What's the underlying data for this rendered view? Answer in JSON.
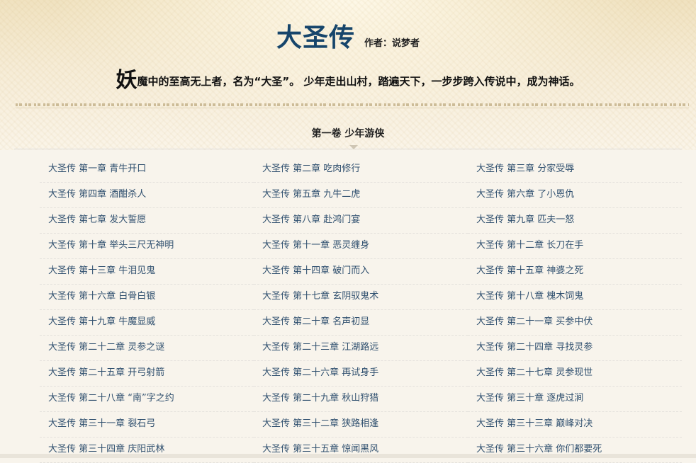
{
  "book": {
    "title": "大圣传",
    "author": "作者：说梦者",
    "intro_dropcap": "妖",
    "intro_rest": "魔中的至高无上者，名为“大圣”。 少年走出山村，踏遍天下，一步步跨入传说中，成为神话。"
  },
  "volume": {
    "title": "第一卷 少年游侠"
  },
  "chapters": [
    "大圣传 第一章 青牛开口",
    "大圣传 第二章 吃肉修行",
    "大圣传 第三章 分家受辱",
    "大圣传 第四章 酒酣杀人",
    "大圣传 第五章 九牛二虎",
    "大圣传 第六章 了小恩仇",
    "大圣传 第七章 发大誓愿",
    "大圣传 第八章 赴鸿门宴",
    "大圣传 第九章 匹夫一怒",
    "大圣传 第十章 举头三尺无神明",
    "大圣传 第十一章 恶灵缠身",
    "大圣传 第十二章 长刀在手",
    "大圣传 第十三章 牛泪见鬼",
    "大圣传 第十四章 破门而入",
    "大圣传 第十五章 神婆之死",
    "大圣传 第十六章 白骨白银",
    "大圣传 第十七章 玄阴驭鬼术",
    "大圣传 第十八章 槐木饲鬼",
    "大圣传 第十九章 牛魔显威",
    "大圣传 第二十章 名声初显",
    "大圣传 第二十一章 买参中伏",
    "大圣传 第二十二章 灵参之谜",
    "大圣传 第二十三章 江湖路远",
    "大圣传 第二十四章 寻找灵参",
    "大圣传 第二十五章 开弓射箭",
    "大圣传 第二十六章 再试身手",
    "大圣传 第二十七章 灵参现世",
    "大圣传 第二十八章 “南”字之约",
    "大圣传 第二十九章 秋山狩猎",
    "大圣传 第三十章 逐虎过涧",
    "大圣传 第三十一章 裂石弓",
    "大圣传 第三十二章 狭路相逢",
    "大圣传 第三十三章 巅峰对决",
    "大圣传 第三十四章 庆阳武林",
    "大圣传 第三十五章 惊闻黑风",
    "大圣传 第三十六章 你们都要死"
  ],
  "colors": {
    "title": "#16456b",
    "link": "#30506f"
  }
}
